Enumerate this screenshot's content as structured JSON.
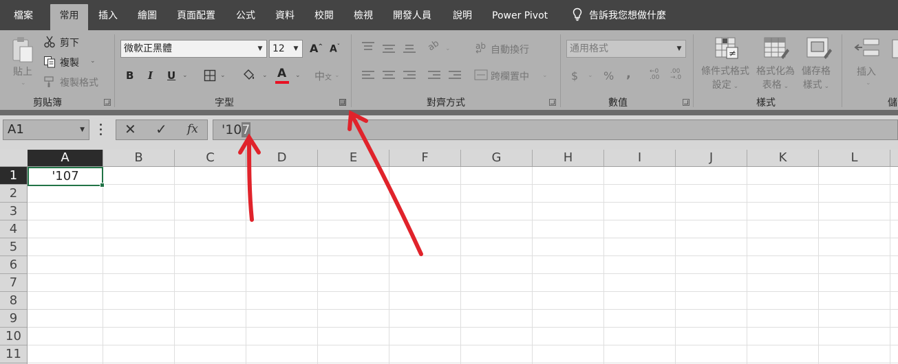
{
  "tabs": [
    "檔案",
    "常用",
    "插入",
    "繪圖",
    "頁面配置",
    "公式",
    "資料",
    "校閱",
    "檢視",
    "開發人員",
    "說明",
    "Power Pivot"
  ],
  "active_tab": "常用",
  "tell_me": "告訴我您想做什麼",
  "clipboard": {
    "paste": "貼上",
    "cut": "剪下",
    "copy": "複製",
    "format_painter": "複製格式",
    "group_label": "剪貼簿"
  },
  "font": {
    "name": "微軟正黑體",
    "size": "12",
    "bold": "B",
    "italic": "I",
    "underline": "U",
    "font_color_letter": "A",
    "font_color": "#e81123",
    "group_label": "字型"
  },
  "alignment": {
    "wrap_text": "自動換行",
    "merge_center": "跨欄置中",
    "group_label": "對齊方式"
  },
  "number": {
    "format": "通用格式",
    "currency": "$",
    "percent": "%",
    "comma": ",",
    "group_label": "數值"
  },
  "styles": {
    "conditional": [
      "條件式格式",
      "設定"
    ],
    "format_table": [
      "格式化為",
      "表格"
    ],
    "cell_styles": [
      "儲存格",
      "樣式"
    ],
    "group_label": "樣式"
  },
  "cells_group": {
    "insert": "插入",
    "group_label_partial": "儲"
  },
  "formula_bar": {
    "name_box": "A1",
    "cancel": "✕",
    "enter": "✓",
    "fx": "fx",
    "content_prefix": "'10",
    "content_selected": "7"
  },
  "sheet": {
    "columns": [
      "A",
      "B",
      "C",
      "D",
      "E",
      "F",
      "G",
      "H",
      "I",
      "J",
      "K",
      "L"
    ],
    "rows": [
      "1",
      "2",
      "3",
      "4",
      "5",
      "6",
      "7",
      "8",
      "9",
      "10",
      "11"
    ],
    "active_cell": "A1",
    "a1_value": "'107"
  },
  "colors": {
    "accent_green": "#217346",
    "annotation_red": "#e0232b"
  }
}
